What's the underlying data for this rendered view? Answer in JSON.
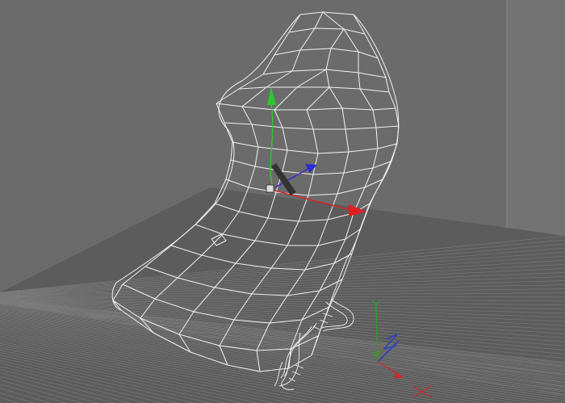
{
  "viewport": {
    "background_color": "#6b6b6b",
    "floor_color": "#585858",
    "grid_line_color": "#7c7c7c",
    "side_wall_color": "#737373",
    "wireframe_color": "#f2f2f2"
  },
  "model": {
    "name": "racing-seat-wireframe",
    "display_mode": "wireframe"
  },
  "gizmo": {
    "x_axis_color": "#e02020",
    "y_axis_color": "#2ec82e",
    "z_axis_color": "#2b2bd8",
    "pivot_icon": "pivot-cube-icon"
  },
  "orientation_indicator": {
    "x_color": "#cc2a2a",
    "y_color": "#2aa02a",
    "z_color": "#2a3ad0"
  }
}
